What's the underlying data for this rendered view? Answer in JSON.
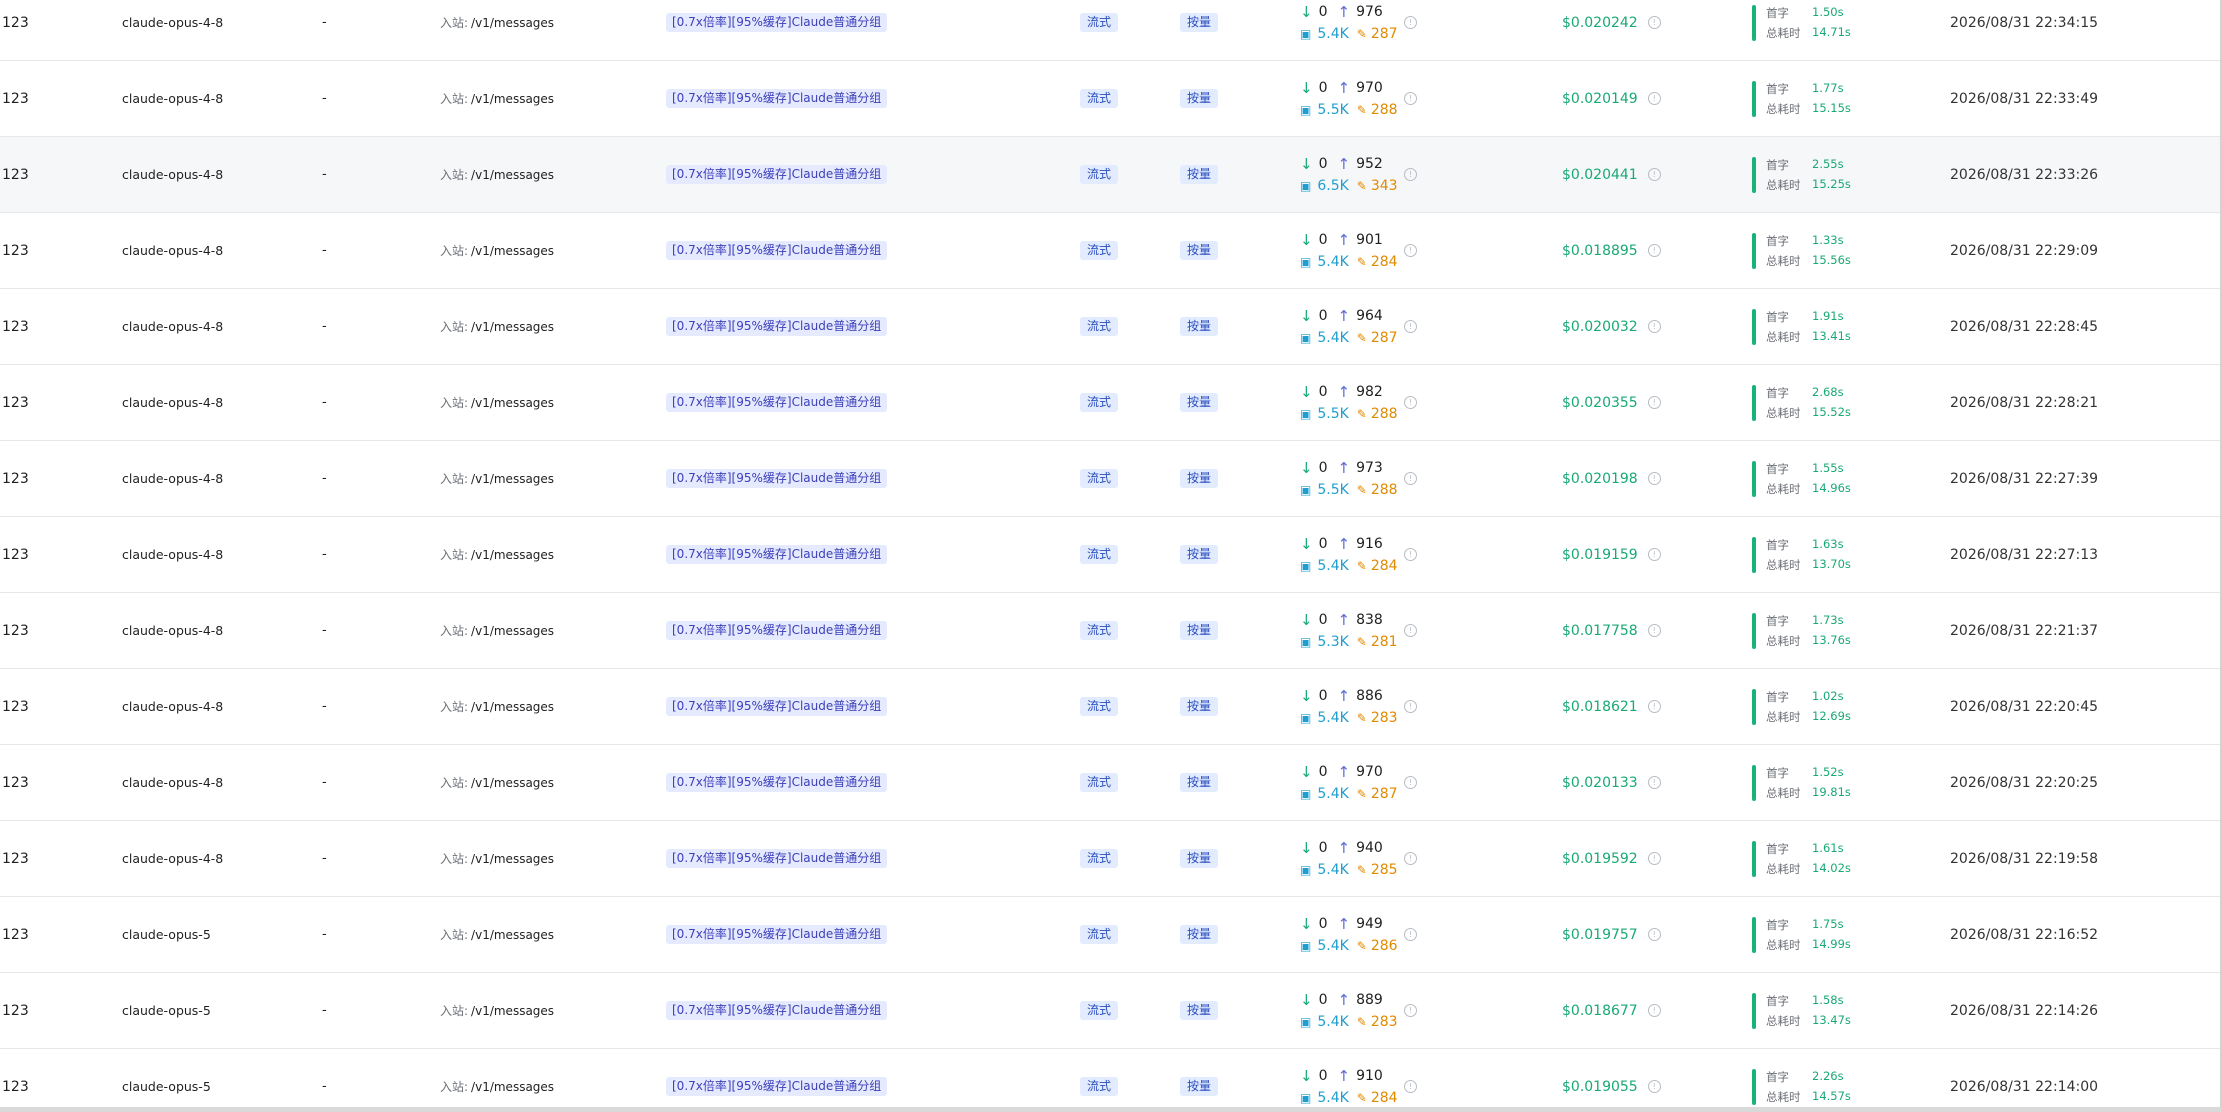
{
  "labels": {
    "endpoint_prefix": "入站:",
    "first_token": "首字",
    "total_time": "总耗时",
    "info_glyph": "!"
  },
  "colors": {
    "cost": "#19a974",
    "cache": "#1f9fcf",
    "output": "#e08a00",
    "tag_bg": "#e6eaff",
    "timing_bar": "#19b37a"
  },
  "icons": {
    "input_tokens": "arrow-down-icon",
    "output_tokens": "arrow-up-icon",
    "cache": "cache-icon",
    "cache_write": "edit-icon",
    "info": "info-icon"
  },
  "rows": [
    {
      "user": "123",
      "model": "claude-opus-4-8",
      "token_name": "-",
      "endpoint": "/v1/messages",
      "group": "[0.7x倍率][95%缓存]Claude普通分组",
      "mode": "流式",
      "billing": "按量",
      "input": "0",
      "output": "976",
      "cache": "5.4K",
      "cache_write": "287",
      "cost": "$0.020242",
      "first": "1.50s",
      "total": "14.71s",
      "time": "2026/08/31 22:34:15"
    },
    {
      "user": "123",
      "model": "claude-opus-4-8",
      "token_name": "-",
      "endpoint": "/v1/messages",
      "group": "[0.7x倍率][95%缓存]Claude普通分组",
      "mode": "流式",
      "billing": "按量",
      "input": "0",
      "output": "970",
      "cache": "5.5K",
      "cache_write": "288",
      "cost": "$0.020149",
      "first": "1.77s",
      "total": "15.15s",
      "time": "2026/08/31 22:33:49"
    },
    {
      "user": "123",
      "model": "claude-opus-4-8",
      "token_name": "-",
      "endpoint": "/v1/messages",
      "group": "[0.7x倍率][95%缓存]Claude普通分组",
      "mode": "流式",
      "billing": "按量",
      "input": "0",
      "output": "952",
      "cache": "6.5K",
      "cache_write": "343",
      "cost": "$0.020441",
      "first": "2.55s",
      "total": "15.25s",
      "time": "2026/08/31 22:33:26",
      "hover": true
    },
    {
      "user": "123",
      "model": "claude-opus-4-8",
      "token_name": "-",
      "endpoint": "/v1/messages",
      "group": "[0.7x倍率][95%缓存]Claude普通分组",
      "mode": "流式",
      "billing": "按量",
      "input": "0",
      "output": "901",
      "cache": "5.4K",
      "cache_write": "284",
      "cost": "$0.018895",
      "first": "1.33s",
      "total": "15.56s",
      "time": "2026/08/31 22:29:09"
    },
    {
      "user": "123",
      "model": "claude-opus-4-8",
      "token_name": "-",
      "endpoint": "/v1/messages",
      "group": "[0.7x倍率][95%缓存]Claude普通分组",
      "mode": "流式",
      "billing": "按量",
      "input": "0",
      "output": "964",
      "cache": "5.4K",
      "cache_write": "287",
      "cost": "$0.020032",
      "first": "1.91s",
      "total": "13.41s",
      "time": "2026/08/31 22:28:45"
    },
    {
      "user": "123",
      "model": "claude-opus-4-8",
      "token_name": "-",
      "endpoint": "/v1/messages",
      "group": "[0.7x倍率][95%缓存]Claude普通分组",
      "mode": "流式",
      "billing": "按量",
      "input": "0",
      "output": "982",
      "cache": "5.5K",
      "cache_write": "288",
      "cost": "$0.020355",
      "first": "2.68s",
      "total": "15.52s",
      "time": "2026/08/31 22:28:21"
    },
    {
      "user": "123",
      "model": "claude-opus-4-8",
      "token_name": "-",
      "endpoint": "/v1/messages",
      "group": "[0.7x倍率][95%缓存]Claude普通分组",
      "mode": "流式",
      "billing": "按量",
      "input": "0",
      "output": "973",
      "cache": "5.5K",
      "cache_write": "288",
      "cost": "$0.020198",
      "first": "1.55s",
      "total": "14.96s",
      "time": "2026/08/31 22:27:39"
    },
    {
      "user": "123",
      "model": "claude-opus-4-8",
      "token_name": "-",
      "endpoint": "/v1/messages",
      "group": "[0.7x倍率][95%缓存]Claude普通分组",
      "mode": "流式",
      "billing": "按量",
      "input": "0",
      "output": "916",
      "cache": "5.4K",
      "cache_write": "284",
      "cost": "$0.019159",
      "first": "1.63s",
      "total": "13.70s",
      "time": "2026/08/31 22:27:13"
    },
    {
      "user": "123",
      "model": "claude-opus-4-8",
      "token_name": "-",
      "endpoint": "/v1/messages",
      "group": "[0.7x倍率][95%缓存]Claude普通分组",
      "mode": "流式",
      "billing": "按量",
      "input": "0",
      "output": "838",
      "cache": "5.3K",
      "cache_write": "281",
      "cost": "$0.017758",
      "first": "1.73s",
      "total": "13.76s",
      "time": "2026/08/31 22:21:37"
    },
    {
      "user": "123",
      "model": "claude-opus-4-8",
      "token_name": "-",
      "endpoint": "/v1/messages",
      "group": "[0.7x倍率][95%缓存]Claude普通分组",
      "mode": "流式",
      "billing": "按量",
      "input": "0",
      "output": "886",
      "cache": "5.4K",
      "cache_write": "283",
      "cost": "$0.018621",
      "first": "1.02s",
      "total": "12.69s",
      "time": "2026/08/31 22:20:45"
    },
    {
      "user": "123",
      "model": "claude-opus-4-8",
      "token_name": "-",
      "endpoint": "/v1/messages",
      "group": "[0.7x倍率][95%缓存]Claude普通分组",
      "mode": "流式",
      "billing": "按量",
      "input": "0",
      "output": "970",
      "cache": "5.4K",
      "cache_write": "287",
      "cost": "$0.020133",
      "first": "1.52s",
      "total": "19.81s",
      "time": "2026/08/31 22:20:25"
    },
    {
      "user": "123",
      "model": "claude-opus-4-8",
      "token_name": "-",
      "endpoint": "/v1/messages",
      "group": "[0.7x倍率][95%缓存]Claude普通分组",
      "mode": "流式",
      "billing": "按量",
      "input": "0",
      "output": "940",
      "cache": "5.4K",
      "cache_write": "285",
      "cost": "$0.019592",
      "first": "1.61s",
      "total": "14.02s",
      "time": "2026/08/31 22:19:58"
    },
    {
      "user": "123",
      "model": "claude-opus-5",
      "token_name": "-",
      "endpoint": "/v1/messages",
      "group": "[0.7x倍率][95%缓存]Claude普通分组",
      "mode": "流式",
      "billing": "按量",
      "input": "0",
      "output": "949",
      "cache": "5.4K",
      "cache_write": "286",
      "cost": "$0.019757",
      "first": "1.75s",
      "total": "14.99s",
      "time": "2026/08/31 22:16:52"
    },
    {
      "user": "123",
      "model": "claude-opus-5",
      "token_name": "-",
      "endpoint": "/v1/messages",
      "group": "[0.7x倍率][95%缓存]Claude普通分组",
      "mode": "流式",
      "billing": "按量",
      "input": "0",
      "output": "889",
      "cache": "5.4K",
      "cache_write": "283",
      "cost": "$0.018677",
      "first": "1.58s",
      "total": "13.47s",
      "time": "2026/08/31 22:14:26"
    },
    {
      "user": "123",
      "model": "claude-opus-5",
      "token_name": "-",
      "endpoint": "/v1/messages",
      "group": "[0.7x倍率][95%缓存]Claude普通分组",
      "mode": "流式",
      "billing": "按量",
      "input": "0",
      "output": "910",
      "cache": "5.4K",
      "cache_write": "284",
      "cost": "$0.019055",
      "first": "2.26s",
      "total": "14.57s",
      "time": "2026/08/31 22:14:00"
    }
  ]
}
